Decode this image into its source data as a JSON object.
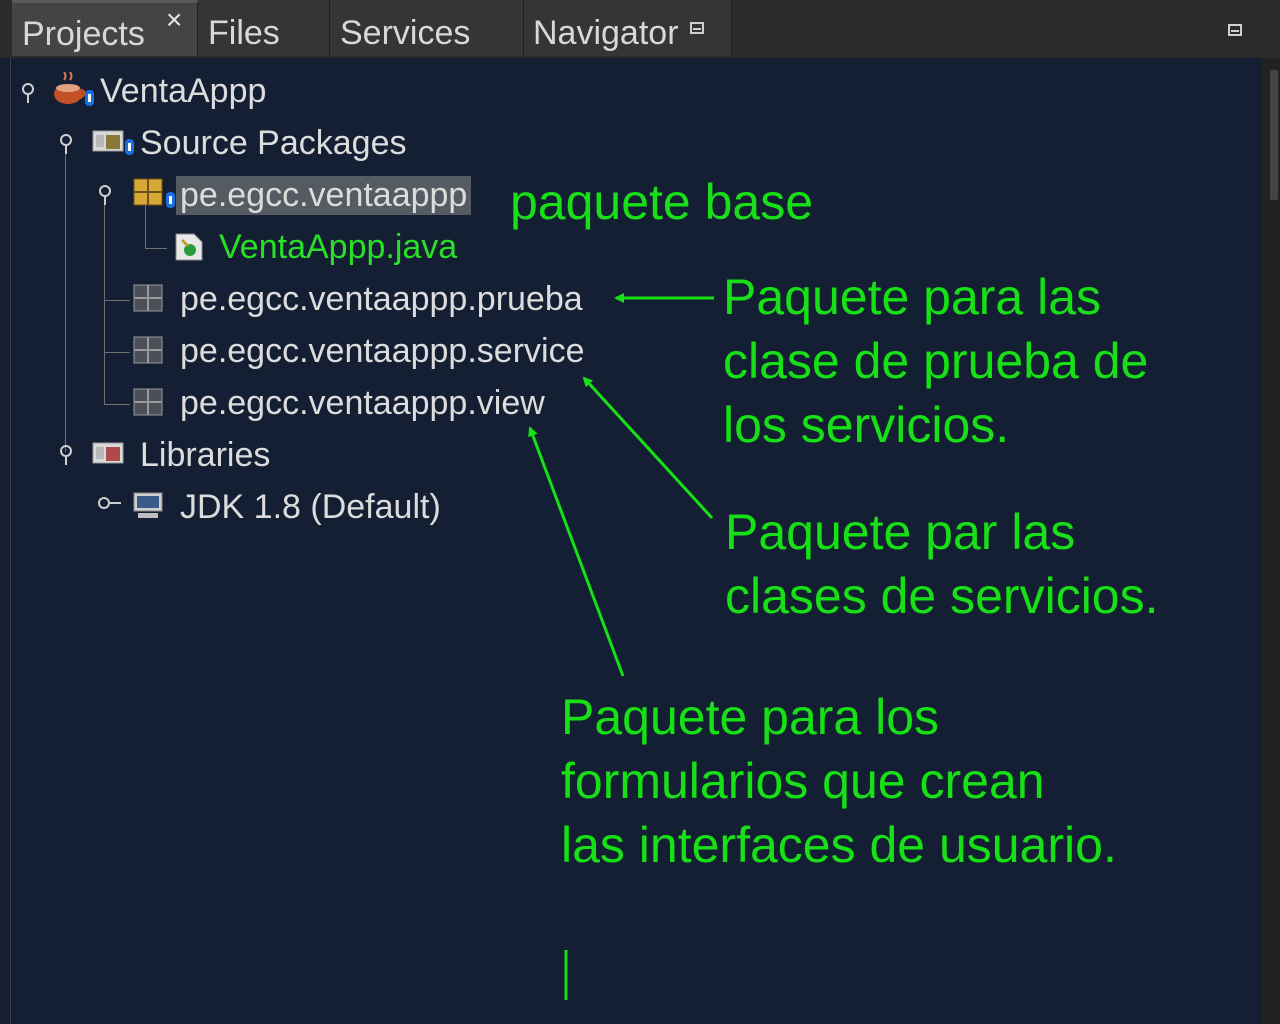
{
  "tabs": [
    {
      "label": "Projects",
      "active": true,
      "closable": true
    },
    {
      "label": "Files"
    },
    {
      "label": "Services"
    },
    {
      "label": "Navigator",
      "has_minimize": true
    }
  ],
  "tab_close_symbol": "×",
  "tree": {
    "project": "VentaAppp",
    "source_packages": "Source Packages",
    "base_package": "pe.egcc.ventaappp",
    "java_file": "VentaAppp.java",
    "package_prueba": "pe.egcc.ventaappp.prueba",
    "package_service": "pe.egcc.ventaappp.service",
    "package_view": "pe.egcc.ventaappp.view",
    "libraries": "Libraries",
    "jdk": "JDK 1.8 (Default)"
  },
  "annotations": {
    "base": "paquete base",
    "prueba_1": "Paquete para las",
    "prueba_2": "clase de prueba de",
    "prueba_3": "los servicios.",
    "service_1": "Paquete par las",
    "service_2": "clases de servicios.",
    "view_1": "Paquete para los",
    "view_2": "formularios que crean",
    "view_3": "las interfaces de usuario."
  },
  "colors": {
    "background": "#151f33",
    "annotation": "#17e017",
    "tree_text": "#dcdcdc",
    "java_file": "#28e028",
    "selection": "#555b62"
  },
  "icons": [
    "coffee-cup-icon",
    "folder-package-icon",
    "package-icon",
    "java-file-icon",
    "library-folder-icon",
    "jdk-monitor-icon",
    "tree-toggle-icon",
    "minimize-icon",
    "close-icon"
  ]
}
